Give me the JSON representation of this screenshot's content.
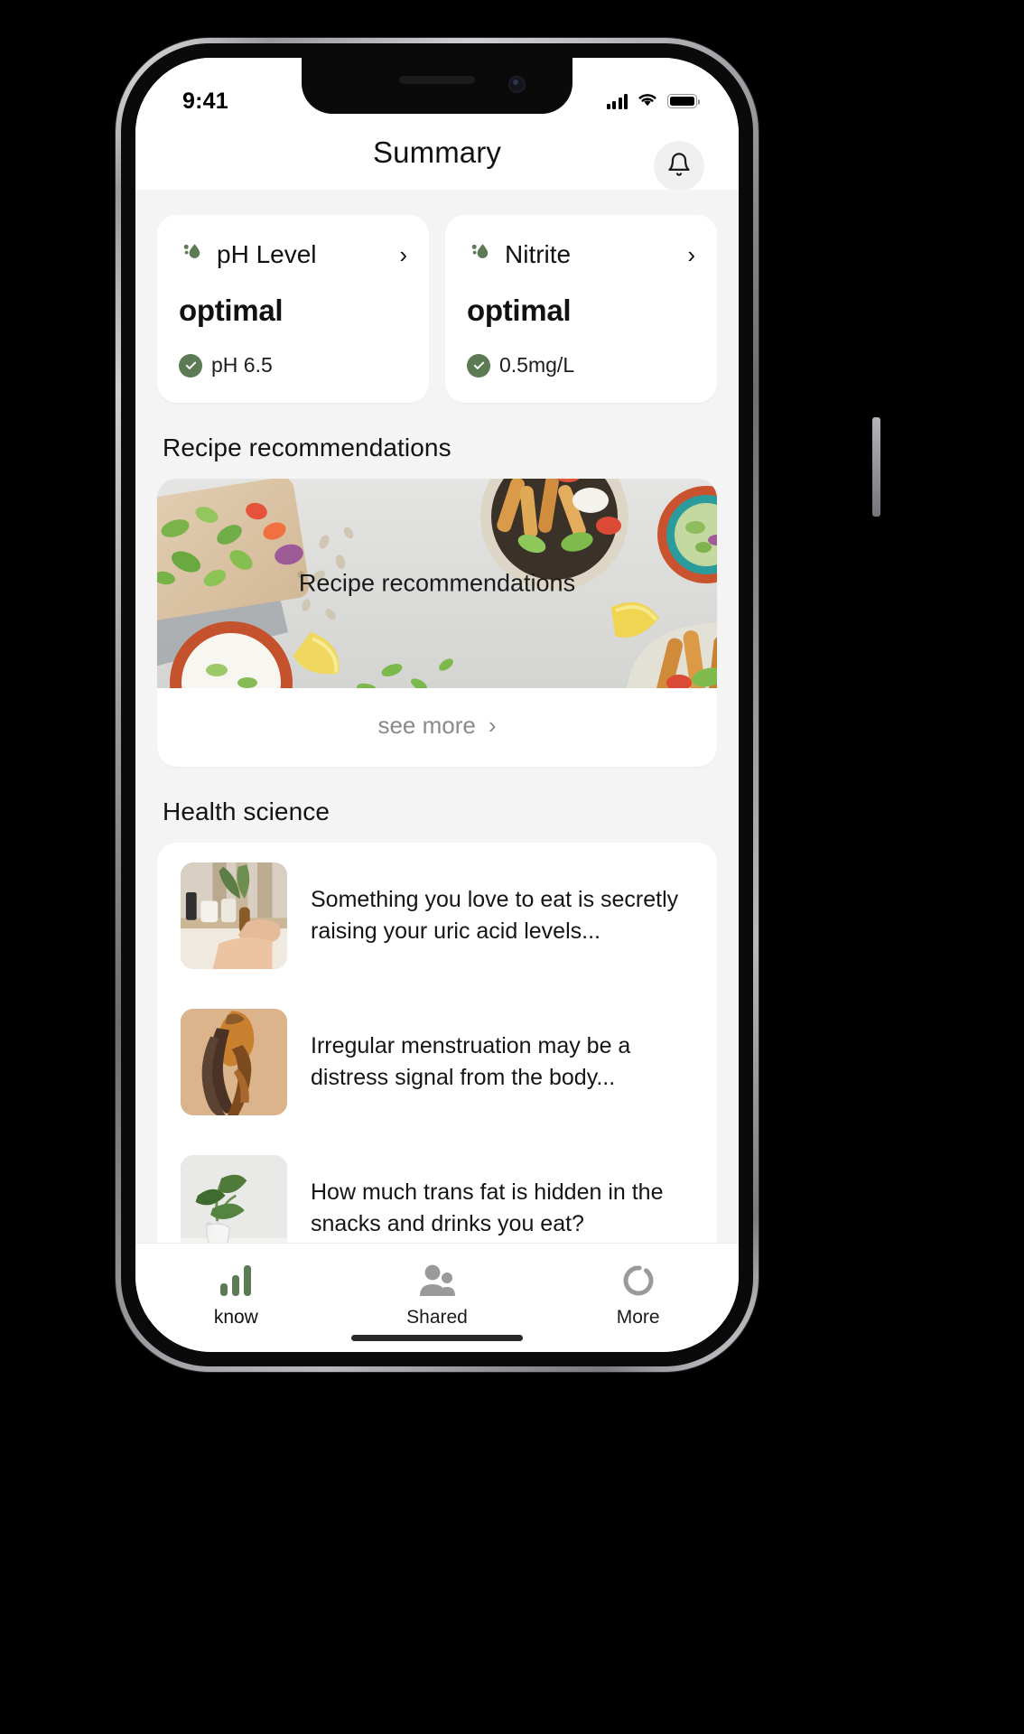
{
  "status_bar": {
    "time": "9:41",
    "cellular_icon": "signal-bars-icon",
    "wifi_icon": "wifi-icon",
    "battery_icon": "battery-full-icon"
  },
  "header": {
    "title": "Summary",
    "notification_icon": "bell-icon"
  },
  "metrics": [
    {
      "name": "pH Level",
      "icon": "water-droplet-icon",
      "chevron": "›",
      "status": "optimal",
      "value": "pH 6.5",
      "check_icon": "check-circle-icon",
      "accent": "#5c7a54"
    },
    {
      "name": "Nitrite",
      "icon": "water-droplet-icon",
      "chevron": "›",
      "status": "optimal",
      "value": "0.5mg/L",
      "check_icon": "check-circle-icon",
      "accent": "#5c7a54"
    }
  ],
  "recipe_section": {
    "heading": "Recipe recommendations",
    "banner_caption": "Recipe recommendations",
    "see_more_label": "see more",
    "see_more_chevron": "›"
  },
  "health_section": {
    "heading": "Health science",
    "articles": [
      {
        "title": "Something you love to eat is secretly raising your uric acid levels...",
        "thumbnail": "hands-on-table-photo"
      },
      {
        "title": "Irregular menstruation may be a distress signal from the body...",
        "thumbnail": "woman-stretching-photo"
      },
      {
        "title": "How much trans fat is hidden in the snacks and drinks you eat?",
        "thumbnail": "plant-in-vase-photo"
      }
    ]
  },
  "tab_bar": {
    "active_index": 0,
    "items": [
      {
        "label": "know",
        "icon": "bar-chart-icon",
        "color": "#5c7a54"
      },
      {
        "label": "Shared",
        "icon": "people-icon",
        "color": "#9a9a9a"
      },
      {
        "label": "More",
        "icon": "circle-dash-icon",
        "color": "#9a9a9a"
      }
    ]
  }
}
